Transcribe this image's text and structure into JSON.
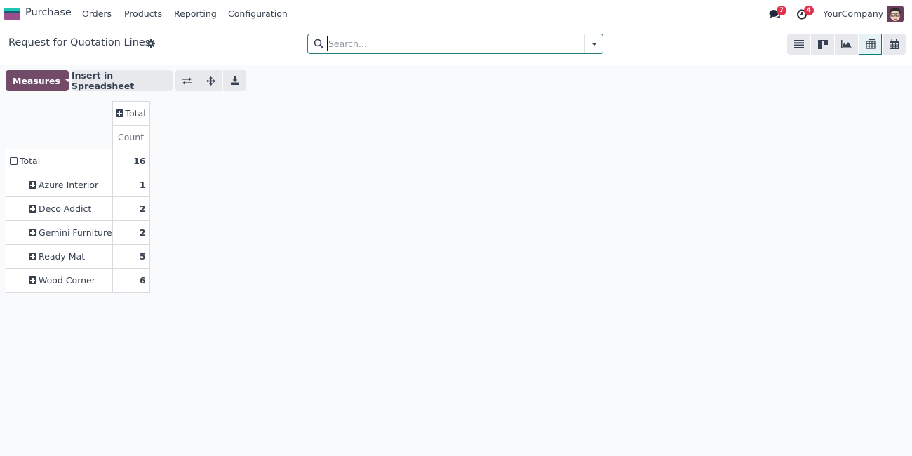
{
  "navbar": {
    "app_name": "Purchase",
    "menu": [
      "Orders",
      "Products",
      "Reporting",
      "Configuration"
    ],
    "messages_badge": "7",
    "activities_badge": "4",
    "company": "YourCompany",
    "icons": {
      "app": "purchase-app-logo",
      "messages": "chat-bubbles-icon",
      "activities": "clock-icon",
      "avatar": "user-avatar"
    },
    "colors": {
      "badge": "#e1314b"
    }
  },
  "control_panel": {
    "title": "Request for Quotation Lines",
    "search": {
      "placeholder": "Search...",
      "value": ""
    },
    "views": [
      {
        "name": "list",
        "icon": "list-icon",
        "active": false
      },
      {
        "name": "kanban",
        "icon": "kanban-icon",
        "active": false
      },
      {
        "name": "graph",
        "icon": "area-chart-icon",
        "active": false
      },
      {
        "name": "pivot",
        "icon": "pivot-table-icon",
        "active": true
      },
      {
        "name": "calendar",
        "icon": "calendar-icon",
        "active": false
      }
    ]
  },
  "toolbar": {
    "measures_label": "Measures",
    "spreadsheet_label": "Insert in Spreadsheet",
    "tools": [
      "flip-axis-icon",
      "expand-all-icon",
      "download-icon"
    ],
    "colors": {
      "primary": "#714b67",
      "accent": "#017e84"
    }
  },
  "pivot": {
    "col_header": "Total",
    "measure": "Count",
    "total_row": {
      "label": "Total",
      "value": "16"
    },
    "rows": [
      {
        "label": "Azure Interior",
        "value": "1"
      },
      {
        "label": "Deco Addict",
        "value": "2"
      },
      {
        "label": "Gemini Furniture",
        "value": "2"
      },
      {
        "label": "Ready Mat",
        "value": "5"
      },
      {
        "label": "Wood Corner",
        "value": "6"
      }
    ]
  }
}
